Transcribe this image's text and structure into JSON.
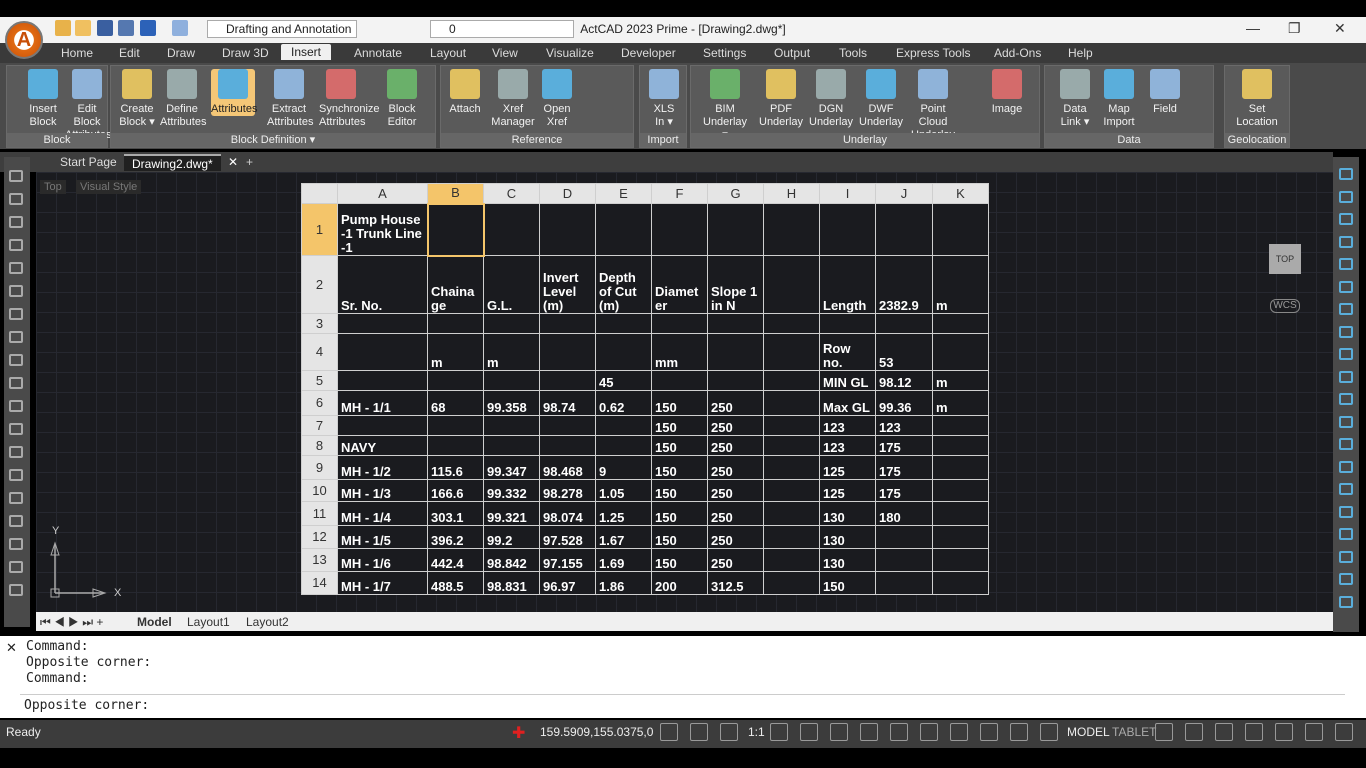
{
  "app": {
    "window_title": "ActCAD 2023 Prime - [Drawing2.dwg*]",
    "workspace": "Drafting and Annotation",
    "layer": "0"
  },
  "ribbon_tabs": [
    "Home",
    "Edit",
    "Draw",
    "Draw 3D",
    "Insert",
    "Annotate",
    "Layout",
    "View",
    "Visualize",
    "Developer",
    "Settings",
    "Output",
    "Tools",
    "Express Tools",
    "Add-Ons",
    "Help"
  ],
  "panels": {
    "block": {
      "title": "Block",
      "buttons": [
        "Insert\nBlock",
        "Edit Block\nAttributes"
      ]
    },
    "block_def": {
      "title": "Block Definition ▾",
      "buttons": [
        "Create\nBlock ▾",
        "Define\nAttributes",
        "Attributes",
        "Extract\nAttributes",
        "Synchronize\nAttributes",
        "Block\nEditor"
      ]
    },
    "reference": {
      "title": "Reference",
      "buttons": [
        "Attach",
        "Xref\nManager",
        "Open\nXref"
      ]
    },
    "import": {
      "title": "Import",
      "buttons": [
        "XLS\nIn ▾"
      ]
    },
    "underlay": {
      "title": "Underlay",
      "buttons": [
        "BIM\nUnderlay ▾",
        "PDF\nUnderlay",
        "DGN\nUnderlay",
        "DWF\nUnderlay",
        "Point Cloud\nUnderlay",
        "Image"
      ]
    },
    "data": {
      "title": "Data",
      "buttons": [
        "Data\nLink ▾",
        "Map\nImport",
        "Field"
      ]
    },
    "geo": {
      "title": "Geolocation",
      "buttons": [
        "Set\nLocation"
      ]
    }
  },
  "doc_tabs": [
    "Start Page",
    "Drawing2.dwg*"
  ],
  "viewport": {
    "view": "Top",
    "style": "Visual Style",
    "navcube": "TOP",
    "wcs": "WCS"
  },
  "table": {
    "columns": [
      "A",
      "B",
      "C",
      "D",
      "E",
      "F",
      "G",
      "H",
      "I",
      "J",
      "K"
    ],
    "rows": [
      [
        "1",
        [
          "Pump House -1 Trunk Line -1",
          "",
          "",
          "",
          "",
          "",
          "",
          "",
          "",
          "",
          ""
        ]
      ],
      [
        "2",
        [
          "Sr. No.",
          "Chaina ge",
          "G.L.",
          "Invert Level (m)",
          "Depth of Cut (m)",
          "Diamet er",
          "Slope 1 in N",
          "",
          "Length",
          "2382.9",
          "m"
        ]
      ],
      [
        "3",
        [
          "",
          "",
          "",
          "",
          "",
          "",
          "",
          "",
          "",
          "",
          ""
        ]
      ],
      [
        "4",
        [
          "",
          "m",
          "m",
          "",
          "",
          "mm",
          "",
          "",
          "Row no.",
          "53",
          ""
        ]
      ],
      [
        "5",
        [
          "",
          "",
          "",
          "",
          "45",
          "",
          "",
          "",
          "MIN GL",
          "98.12",
          "m"
        ]
      ],
      [
        "6",
        [
          "MH - 1/1",
          "68",
          "99.358",
          "98.74",
          "0.62",
          "150",
          "250",
          "",
          "Max GL",
          "99.36",
          "m"
        ]
      ],
      [
        "7",
        [
          "",
          "",
          "",
          "",
          "",
          "150",
          "250",
          "",
          "123",
          "123",
          ""
        ]
      ],
      [
        "8",
        [
          "NAVY",
          "",
          "",
          "",
          "",
          "150",
          "250",
          "",
          "123",
          "175",
          ""
        ]
      ],
      [
        "9",
        [
          "MH - 1/2",
          "115.6",
          "99.347",
          "98.468",
          "9",
          "150",
          "250",
          "",
          "125",
          "175",
          ""
        ]
      ],
      [
        "10",
        [
          "MH - 1/3",
          "166.6",
          "99.332",
          "98.278",
          "1.05",
          "150",
          "250",
          "",
          "125",
          "175",
          ""
        ]
      ],
      [
        "11",
        [
          "MH - 1/4",
          "303.1",
          "99.321",
          "98.074",
          "1.25",
          "150",
          "250",
          "",
          "130",
          "180",
          ""
        ]
      ],
      [
        "12",
        [
          "MH - 1/5",
          "396.2",
          "99.2",
          "97.528",
          "1.67",
          "150",
          "250",
          "",
          "130",
          "",
          ""
        ]
      ],
      [
        "13",
        [
          "MH - 1/6",
          "442.4",
          "98.842",
          "97.155",
          "1.69",
          "150",
          "250",
          "",
          "130",
          "",
          ""
        ]
      ],
      [
        "14",
        [
          "MH - 1/7",
          "488.5",
          "98.831",
          "96.97",
          "1.86",
          "200",
          "312.5",
          "",
          "150",
          "",
          ""
        ]
      ]
    ]
  },
  "axes": {
    "y": "Y",
    "x": "X"
  },
  "layout_tabs": [
    "Model",
    "Layout1",
    "Layout2"
  ],
  "command": {
    "lines": [
      "Command:",
      "Opposite corner:",
      "Command:"
    ],
    "input": "Opposite corner:"
  },
  "status": {
    "ready": "Ready",
    "coords": "159.5909,155.0375,0",
    "scale": "1:1",
    "model": "MODEL",
    "tablet": "TABLET"
  }
}
